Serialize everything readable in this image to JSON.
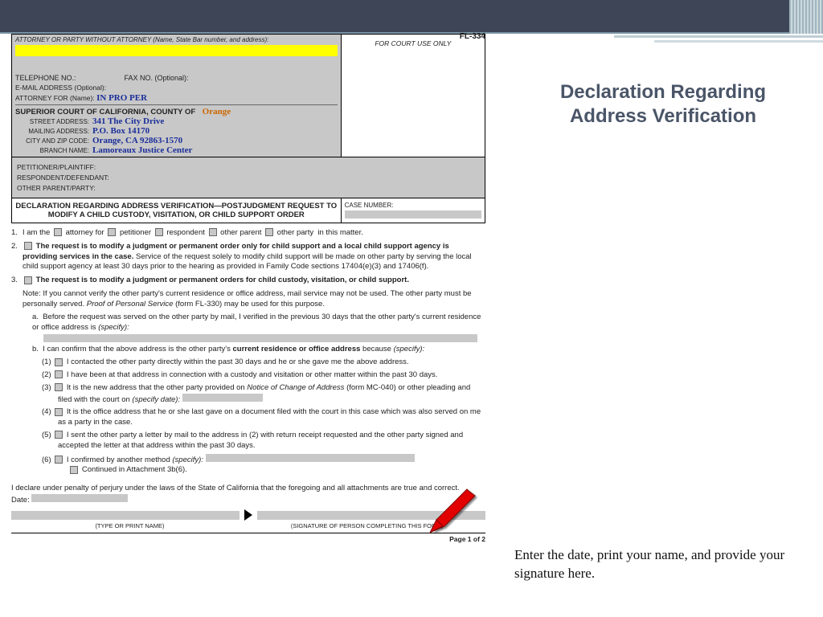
{
  "form_id": "FL-334",
  "header": {
    "attorney_label": "ATTORNEY OR PARTY WITHOUT ATTORNEY (Name, State Bar number, and address):",
    "court_use": "FOR COURT USE ONLY",
    "telephone": "TELEPHONE NO.:",
    "fax": "FAX NO. (Optional):",
    "email": "E-MAIL ADDRESS (Optional):",
    "atty_for": "ATTORNEY FOR (Name):",
    "in_pro_per": "IN PRO PER"
  },
  "court": {
    "title": "SUPERIOR COURT OF CALIFORNIA, COUNTY OF",
    "county": "Orange",
    "street_lbl": "STREET ADDRESS:",
    "street": "341 The City Drive",
    "mail_lbl": "MAILING ADDRESS:",
    "mail": "P.O. Box 14170",
    "city_lbl": "CITY AND ZIP CODE:",
    "city": "Orange, CA 92863-1570",
    "branch_lbl": "BRANCH NAME:",
    "branch": "Lamoreaux Justice Center"
  },
  "parties": {
    "pet": "PETITIONER/PLAINTIFF:",
    "resp": "RESPONDENT/DEFENDANT:",
    "other": "OTHER PARENT/PARTY:"
  },
  "doc_title": "DECLARATION REGARDING ADDRESS VERIFICATION—POSTJUDGMENT REQUEST TO MODIFY A CHILD CUSTODY, VISITATION, OR CHILD SUPPORT ORDER",
  "case_lbl": "CASE NUMBER:",
  "items": {
    "i1": "I am the",
    "i1a": "attorney for",
    "i1b": "petitioner",
    "i1c": "respondent",
    "i1d": "other parent",
    "i1e": "other party",
    "i1f": "in this matter.",
    "i2a": "The request is to modify a judgment or permanent order only for child support and a local child support agency is providing services in the case.",
    "i2b": " Service of the request solely to modify child support will be made on other party by serving the local child support agency at least 30 days prior to the hearing as provided in Family Code sections 17404(e)(3) and 17406(f).",
    "i3a": "The request is to modify a judgment or permanent orders for child custody, visitation, or child support.",
    "i3note": "Note: If you cannot verify the other party's current residence or office address, mail service may not be used. The other party must be personally served. ",
    "i3note2": "Proof of Personal Service",
    "i3note3": " (form FL-330) may be used for this purpose.",
    "i3aa": "Before the request was served on the other party by mail, I verified in the previous 30 days that the other party's current residence or office address is ",
    "specify": "(specify):",
    "i3b": "I can confirm that the above address is the other party's ",
    "i3b2": "current residence or office address",
    "i3b3": " because ",
    "s1": "I contacted the other party directly within the past 30 days and he or she gave me the above address.",
    "s2": "I have been at that address in connection with a custody and visitation or other matter within the past 30 days.",
    "s3a": "It is the new address that the other party provided on ",
    "s3b": "Notice of Change of Address",
    "s3c": " (form MC-040) or other pleading and filed with the court on ",
    "s3d": "(specify date):",
    "s4": "It is the office address that he or she last gave on a document filed with the court in this case which was also served on me as a party in the case.",
    "s5": "I sent the other party a letter by mail to the address in (2) with return receipt requested and the other party signed and accepted the letter at that address within the past 30 days.",
    "s6a": "I confirmed by another method ",
    "s6b": "Continued in Attachment 3b(6)."
  },
  "declare": "I declare under penalty of perjury under the laws of the State of California that the foregoing and all attachments are true and correct.",
  "date_lbl": "Date:",
  "sig1": "(TYPE OR PRINT NAME)",
  "sig2": "(SIGNATURE OF PERSON COMPLETING THIS FORM)",
  "page": "Page 1 of 2",
  "right": {
    "title1": "Declaration Regarding",
    "title2": "Address Verification",
    "note": "Enter the date, print your name, and provide your signature here."
  }
}
